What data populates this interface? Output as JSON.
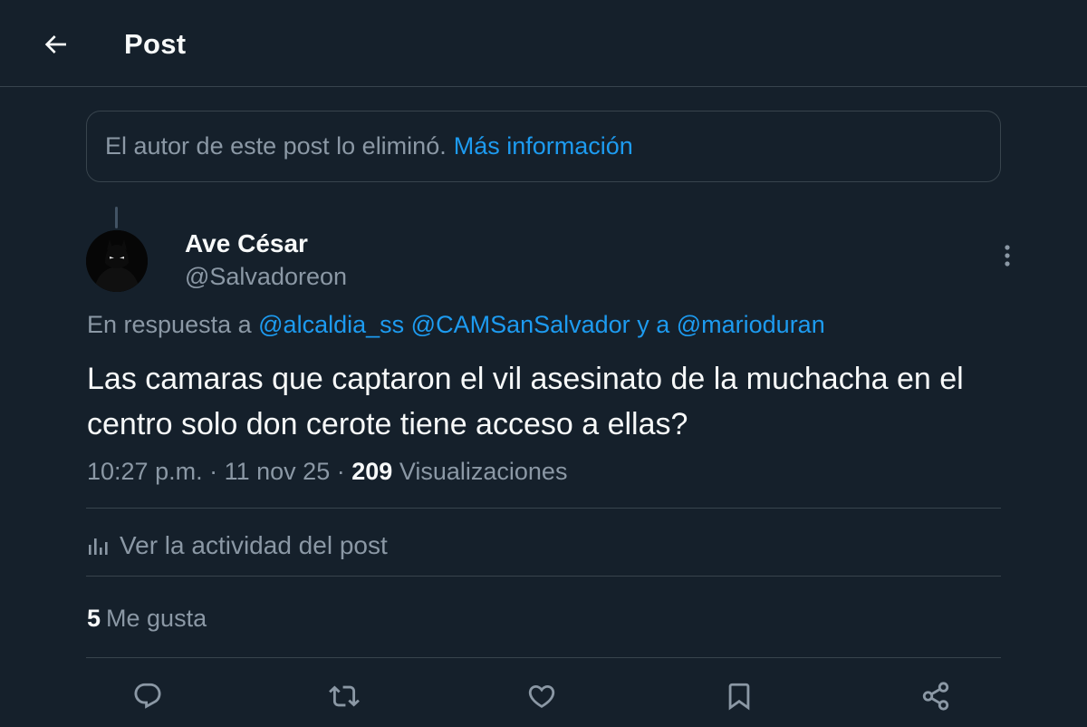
{
  "header": {
    "title": "Post",
    "back_icon": "arrow-left-icon"
  },
  "deleted_notice": {
    "text": "El autor de este post lo eliminó.",
    "link": "Más información"
  },
  "author": {
    "name": "Ave César",
    "handle": "@Salvadoreon"
  },
  "reply": {
    "prefix": "En respuesta a",
    "mention_1": "@alcaldia_ss",
    "mention_2": "@CAMSanSalvador",
    "connector": "y a",
    "mention_3": "@marioduran"
  },
  "post": {
    "text": "Las camaras que captaron el vil asesinato de la muchacha en el centro solo don cerote tiene acceso a ellas?",
    "time": "10:27 p.m.",
    "date": "11 nov 25",
    "views_count": "209",
    "views_label": "Visualizaciones",
    "separator": "·"
  },
  "activity": {
    "label": "Ver la actividad del post",
    "icon": "analytics-icon"
  },
  "stats": {
    "likes_count": "5",
    "likes_label": "Me gusta"
  },
  "actions": [
    "reply-icon",
    "repost-icon",
    "like-icon",
    "bookmark-icon",
    "share-icon"
  ],
  "colors": {
    "background": "#15202b",
    "accent": "#1d9bf0",
    "secondary_text": "#8b98a5",
    "border": "#38444d"
  }
}
